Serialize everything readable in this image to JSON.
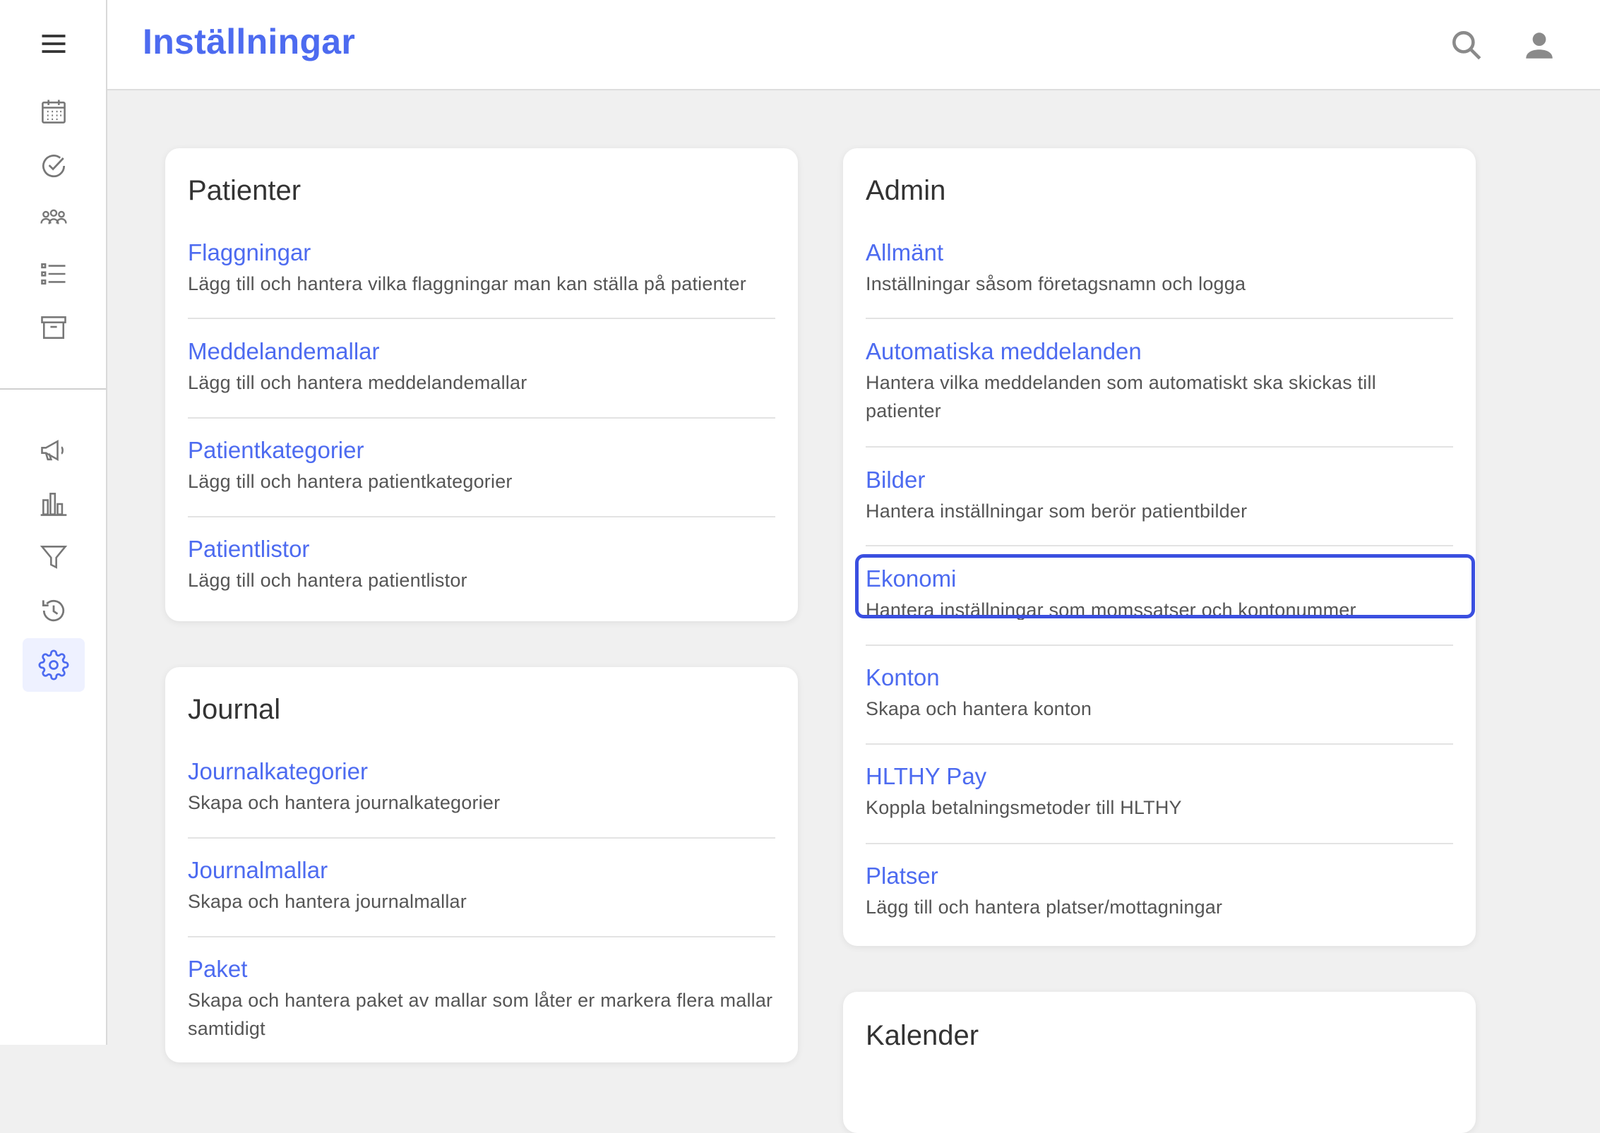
{
  "header": {
    "title": "Inställningar"
  },
  "sidebar": {
    "icons": [
      "menu-icon",
      "calendar-icon",
      "check-circle-icon",
      "group-icon",
      "list-icon",
      "archive-icon",
      "megaphone-icon",
      "bar-chart-icon",
      "filter-icon",
      "history-icon",
      "settings-icon"
    ]
  },
  "colors": {
    "accent": "#4d6bf0",
    "focus": "#3a4fe0",
    "background": "#f0f0f0"
  },
  "sections": {
    "patienter": {
      "title": "Patienter",
      "items": [
        {
          "label": "Flaggningar",
          "desc": "Lägg till och hantera vilka flaggningar man kan ställa på patienter"
        },
        {
          "label": "Meddelandemallar",
          "desc": "Lägg till och hantera meddelandemallar"
        },
        {
          "label": "Patientkategorier",
          "desc": "Lägg till och hantera patientkategorier"
        },
        {
          "label": "Patientlistor",
          "desc": "Lägg till och hantera patientlistor"
        }
      ]
    },
    "journal": {
      "title": "Journal",
      "items": [
        {
          "label": "Journalkategorier",
          "desc": "Skapa och hantera journalkategorier"
        },
        {
          "label": "Journalmallar",
          "desc": "Skapa och hantera journalmallar"
        },
        {
          "label": "Paket",
          "desc": "Skapa och hantera paket av mallar som låter er markera flera mallar samtidigt"
        }
      ]
    },
    "admin": {
      "title": "Admin",
      "items": [
        {
          "label": "Allmänt",
          "desc": "Inställningar såsom företagsnamn och logga"
        },
        {
          "label": "Automatiska meddelanden",
          "desc": "Hantera vilka meddelanden som automatiskt ska skickas till patienter"
        },
        {
          "label": "Bilder",
          "desc": "Hantera inställningar som berör patientbilder"
        },
        {
          "label": "Ekonomi",
          "desc": "Hantera inställningar som momssatser och kontonummer"
        },
        {
          "label": "Konton",
          "desc": "Skapa och hantera konton"
        },
        {
          "label": "HLTHY Pay",
          "desc": "Koppla betalningsmetoder till HLTHY"
        },
        {
          "label": "Platser",
          "desc": "Lägg till och hantera platser/mottagningar"
        }
      ]
    },
    "kalender": {
      "title": "Kalender"
    }
  }
}
